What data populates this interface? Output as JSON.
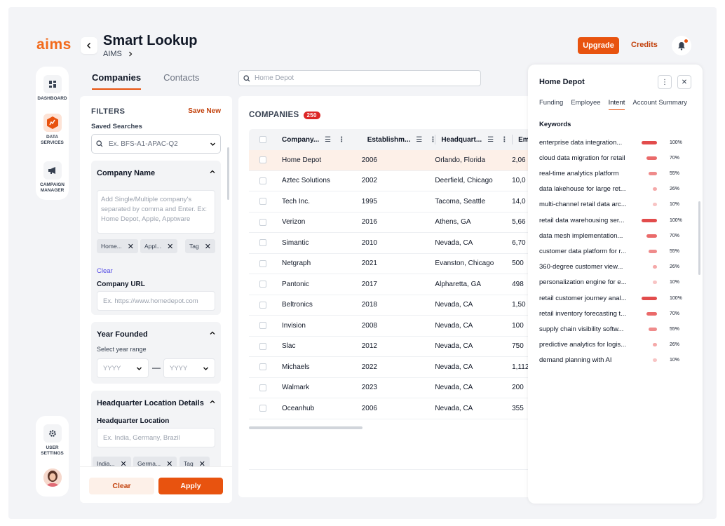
{
  "app": {
    "logo": "aims",
    "title": "Smart Lookup",
    "breadcrumb": "AIMS"
  },
  "header": {
    "upgrade_label": "Upgrade",
    "credits_label": "Credits"
  },
  "sidebar": {
    "items": [
      {
        "label": "DASHBOARD",
        "icon": "dashboard-icon"
      },
      {
        "label": "DATA SERVICES",
        "icon": "data-services-icon"
      },
      {
        "label": "CAMPAIGN MANAGER",
        "icon": "megaphone-icon"
      }
    ],
    "settings_label": "USER SETTINGS"
  },
  "tabs": [
    {
      "label": "Companies",
      "active": true
    },
    {
      "label": "Contacts",
      "active": false
    }
  ],
  "search": {
    "value": "Home Depot"
  },
  "filters": {
    "title": "FILTERS",
    "save_new": "Save New",
    "saved_label": "Saved Searches",
    "saved_placeholder": "Ex. BFS-A1-APAC-Q2",
    "company_name": {
      "title": "Company Name",
      "placeholder": "Add Single/Multiple company's separated by comma and Enter. Ex: Home Depot, Apple, Apptware",
      "chips": [
        "Home...",
        "Appl...",
        "Tag"
      ],
      "clear": "Clear"
    },
    "company_url": {
      "label": "Company URL",
      "placeholder": "Ex.  https://www.homedepot.com"
    },
    "year_founded": {
      "title": "Year Founded",
      "sub": "Select year range",
      "from": "YYYY",
      "to": "YYYY",
      "dash": "—"
    },
    "hq": {
      "title": "Headquarter Location Details",
      "label": "Headquarter Location",
      "placeholder": "Ex. India, Germany, Brazil",
      "chips": [
        "India...",
        "Germa...",
        "Tag"
      ]
    },
    "clear_btn": "Clear",
    "apply_btn": "Apply"
  },
  "companies": {
    "title": "COMPANIES",
    "count": "250",
    "columns": [
      "Company...",
      "Establishm...",
      "Headquart...",
      "Emp"
    ],
    "rows": [
      {
        "name": "Home Depot",
        "est": "2006",
        "hq": "Orlando, Florida",
        "emp": "2,06"
      },
      {
        "name": "Aztec Solutions",
        "est": "2002",
        "hq": "Deerfield, Chicago",
        "emp": "10,0"
      },
      {
        "name": "Tech Inc.",
        "est": "1995",
        "hq": "Tacoma, Seattle",
        "emp": "14,0"
      },
      {
        "name": "Verizon",
        "est": "2016",
        "hq": "Athens, GA",
        "emp": "5,66"
      },
      {
        "name": " Simantic",
        "est": "2010",
        "hq": "Nevada, CA",
        "emp": "6,70"
      },
      {
        "name": "Netgraph",
        "est": "2021",
        "hq": "Evanston, Chicago",
        "emp": "500"
      },
      {
        "name": "Pantonic",
        "est": "2017",
        "hq": "Alpharetta, GA",
        "emp": "498"
      },
      {
        "name": "Beltronics",
        "est": "2018",
        "hq": "Nevada, CA",
        "emp": "1,50"
      },
      {
        "name": "Invision",
        "est": "2008",
        "hq": "Nevada, CA",
        "emp": "100"
      },
      {
        "name": "Slac",
        "est": "2012",
        "hq": "Nevada, CA",
        "emp": "750"
      },
      {
        "name": "Michaels",
        "est": "2022",
        "hq": "Nevada, CA",
        "emp": "1,112"
      },
      {
        "name": "Walmark",
        "est": "2023",
        "hq": "Nevada, CA",
        "emp": "200"
      },
      {
        "name": "Oceanhub",
        "est": "2006",
        "hq": "Nevada, CA",
        "emp": "355"
      }
    ]
  },
  "detail": {
    "title": "Home Depot",
    "tabs": [
      {
        "label": "Funding",
        "active": false
      },
      {
        "label": "Employee",
        "active": false
      },
      {
        "label": "Intent",
        "active": true
      },
      {
        "label": "Account Summary",
        "active": false
      }
    ],
    "keywords_label": "Keywords",
    "keywords": [
      {
        "text": "enterprise data integration...",
        "pct": "100%",
        "level": 1.0,
        "color": "#e24c4c"
      },
      {
        "text": "cloud data migration for retail",
        "pct": "70%",
        "level": 0.7,
        "color": "#ea6a6a"
      },
      {
        "text": "real-time analytics platform",
        "pct": "55%",
        "level": 0.55,
        "color": "#ef8b8b"
      },
      {
        "text": "data lakehouse for large ret...",
        "pct": "26%",
        "level": 0.26,
        "color": "#f5a9a9"
      },
      {
        "text": "multi-channel retail data arc...",
        "pct": "10%",
        "level": 0.1,
        "color": "#f8c4c4"
      },
      {
        "text": "retail data warehousing ser...",
        "pct": "100%",
        "level": 1.0,
        "color": "#e24c4c"
      },
      {
        "text": "data mesh implementation...",
        "pct": "70%",
        "level": 0.7,
        "color": "#ea6a6a"
      },
      {
        "text": "customer data platform for r...",
        "pct": "55%",
        "level": 0.55,
        "color": "#ef8b8b"
      },
      {
        "text": "360-degree customer view...",
        "pct": "26%",
        "level": 0.26,
        "color": "#f5a9a9"
      },
      {
        "text": "personalization engine for e...",
        "pct": "10%",
        "level": 0.1,
        "color": "#f8c4c4"
      },
      {
        "text": "retail customer journey anal...",
        "pct": "100%",
        "level": 1.0,
        "color": "#e24c4c"
      },
      {
        "text": "retail inventory forecasting t...",
        "pct": "70%",
        "level": 0.7,
        "color": "#ea6a6a"
      },
      {
        "text": "supply chain visibility softw...",
        "pct": "55%",
        "level": 0.55,
        "color": "#ef8b8b"
      },
      {
        "text": "predictive analytics for logis...",
        "pct": "26%",
        "level": 0.26,
        "color": "#f5a9a9"
      },
      {
        "text": "demand planning with AI",
        "pct": "10%",
        "level": 0.1,
        "color": "#f8c4c4"
      }
    ]
  },
  "colors": {
    "accent": "#e8530f",
    "accent_soft": "#fdf0e8"
  }
}
